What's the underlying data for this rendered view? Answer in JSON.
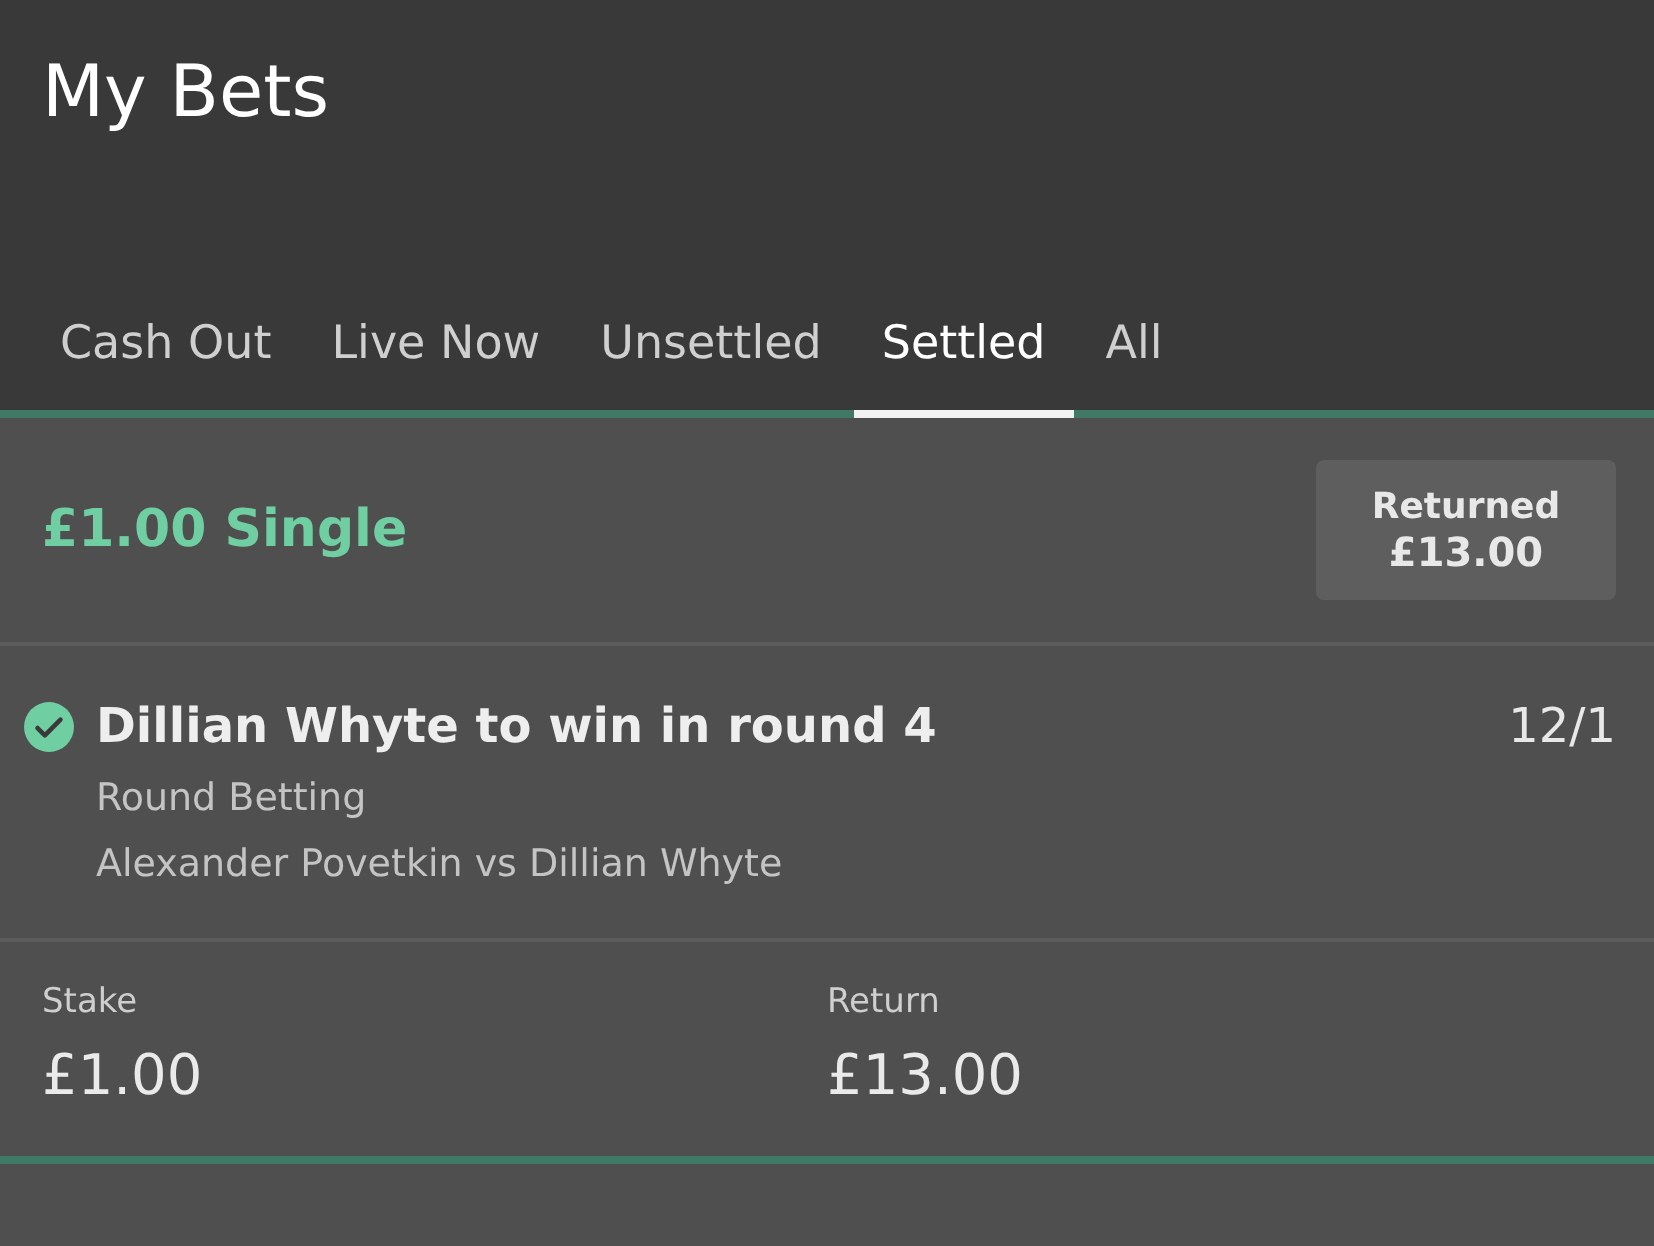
{
  "header": {
    "title": "My Bets"
  },
  "tabs": [
    {
      "label": "Cash Out",
      "selected": false
    },
    {
      "label": "Live Now",
      "selected": false
    },
    {
      "label": "Unsettled",
      "selected": false
    },
    {
      "label": "Settled",
      "selected": true
    },
    {
      "label": "All",
      "selected": false
    }
  ],
  "bets": [
    {
      "title": "£1.00 Single",
      "status_badge": {
        "label": "Returned",
        "amount": "£13.00"
      },
      "selections": [
        {
          "won": true,
          "name": "Dillian Whyte to win in round 4",
          "odds": "12/1",
          "market": "Round Betting",
          "event": "Alexander Povetkin vs Dillian Whyte"
        }
      ],
      "stake": {
        "label": "Stake",
        "value": "£1.00"
      },
      "return": {
        "label": "Return",
        "value": "£13.00"
      }
    }
  ]
}
